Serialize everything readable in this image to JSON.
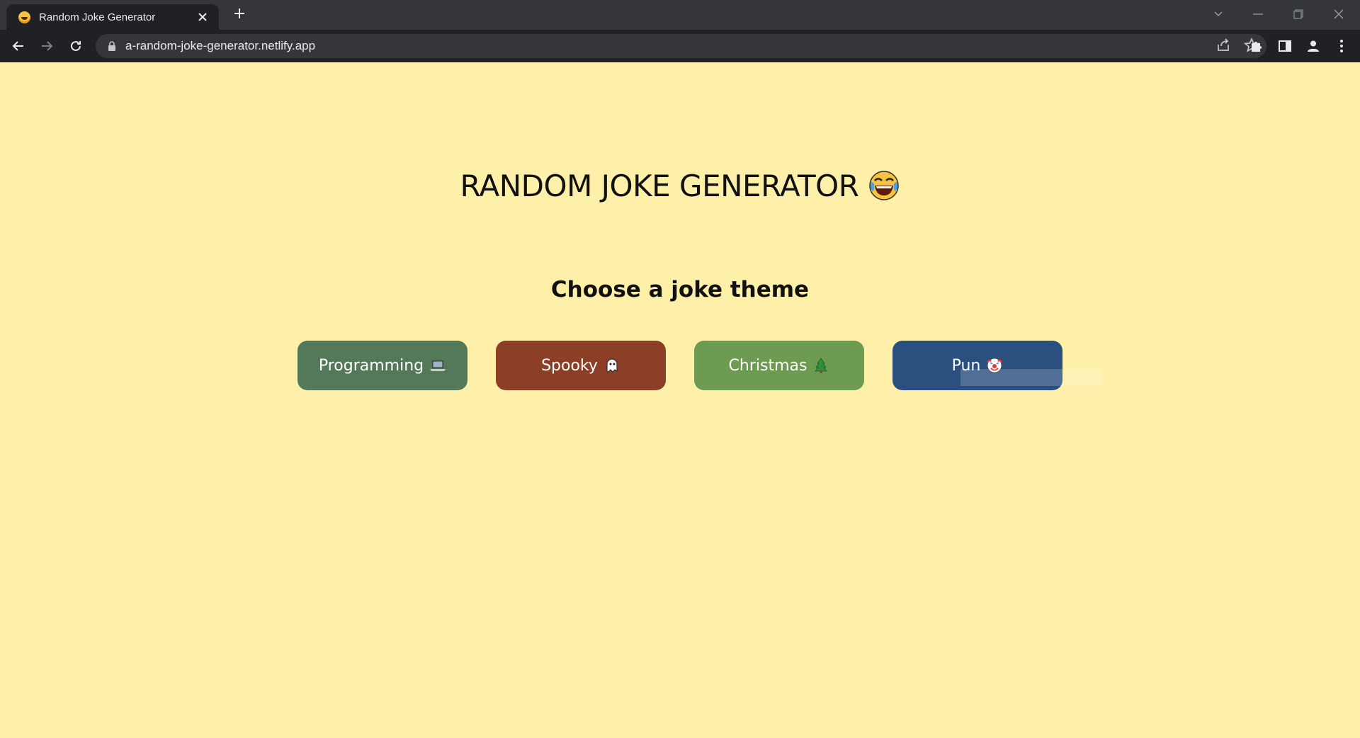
{
  "browser": {
    "tab_title": "Random Joke Generator",
    "url": "a-random-joke-generator.netlify.app"
  },
  "page": {
    "title": "RANDOM JOKE GENERATOR",
    "subtitle": "Choose a joke theme",
    "background": "#fff0a9",
    "buttons": [
      {
        "label": "Programming",
        "icon": "laptop-icon",
        "color": "#537959"
      },
      {
        "label": "Spooky",
        "icon": "ghost-icon",
        "color": "#8a3f26"
      },
      {
        "label": "Christmas",
        "icon": "christmas-tree-icon",
        "color": "#6e9b52"
      },
      {
        "label": "Pun",
        "icon": "clown-face-icon",
        "color": "#2b4f7f"
      }
    ]
  }
}
